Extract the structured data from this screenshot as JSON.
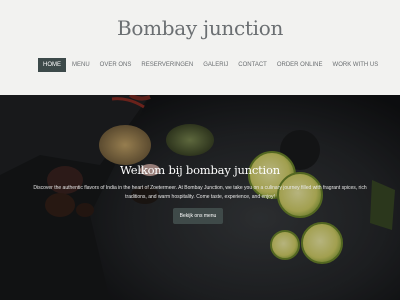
{
  "site": {
    "title": "Bombay junction"
  },
  "nav": {
    "items": [
      {
        "label": "HOME",
        "active": true
      },
      {
        "label": "MENU"
      },
      {
        "label": "OVER ONS"
      },
      {
        "label": "RESERVERINGEN"
      },
      {
        "label": "GALERIJ"
      },
      {
        "label": "CONTACT"
      },
      {
        "label": "ORDER ONLINE"
      },
      {
        "label": "WORK WITH US"
      }
    ]
  },
  "hero": {
    "title": "Welkom bij bombay junction",
    "description": "Discover the authentic flavors of India in the heart of Zoetermeer. At Bombay Junction, we take you on a culinary journey filled with fragrant spices, rich traditions, and warm hospitality. Come taste, experience, and enjoy!",
    "button_label": "Bekijk ons menu"
  },
  "colors": {
    "nav_active_bg": "#3d4a4a",
    "hero_button_bg": "#3f4a49",
    "page_bg": "#f2f2f0"
  }
}
